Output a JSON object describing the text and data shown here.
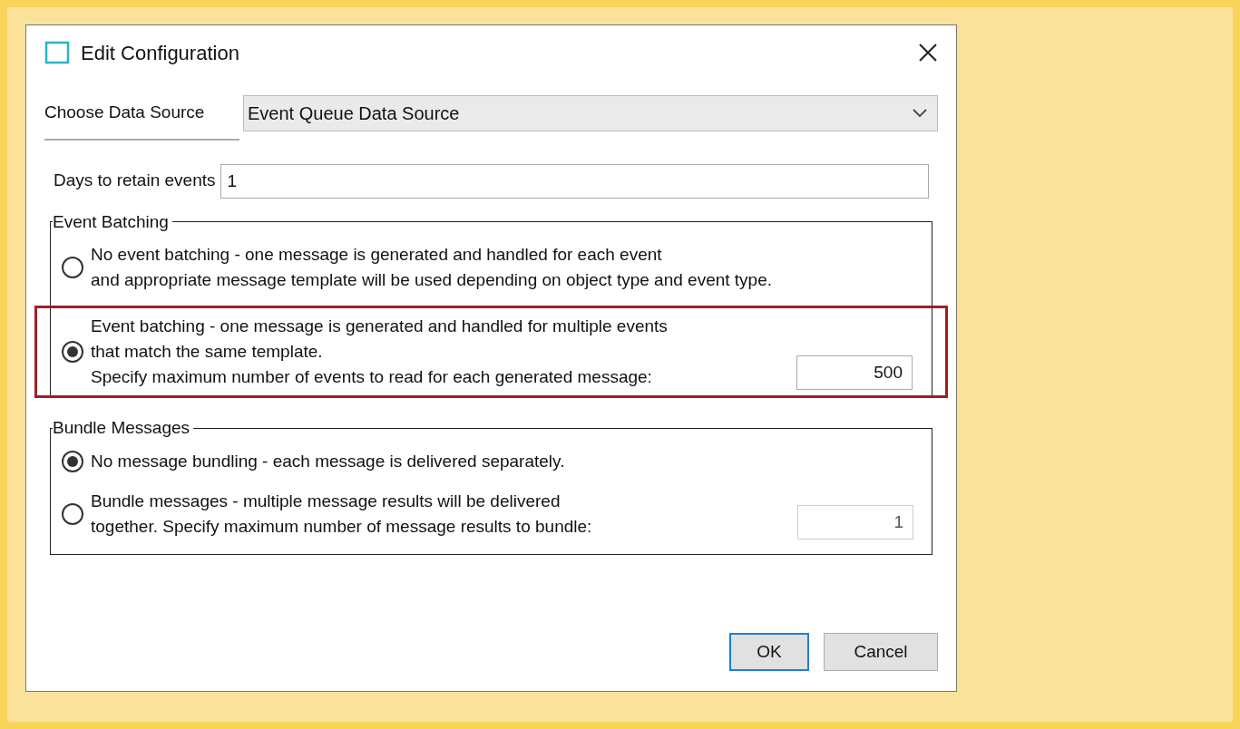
{
  "window": {
    "title": "Edit Configuration"
  },
  "data_source": {
    "label": "Choose Data Source",
    "value": "Event Queue Data Source"
  },
  "days": {
    "label": "Days to retain events",
    "value": "1"
  },
  "groups": [
    {
      "title": "Event Batching",
      "options": [
        {
          "text": "No event batching - one message is generated and handled for each event\nand appropriate message template will be used depending on object type and event type.",
          "selected": false,
          "highlighted": false
        },
        {
          "text": "Event batching - one message is generated and handled for multiple events\nthat match the same template.\nSpecify maximum number of events to read for each generated message:",
          "selected": true,
          "highlighted": true,
          "field": {
            "value": "500",
            "disabled": false
          }
        }
      ]
    },
    {
      "title": "Bundle Messages",
      "options": [
        {
          "text": "No message bundling - each message is delivered separately.",
          "selected": true,
          "highlighted": false
        },
        {
          "text": "Bundle messages - multiple message results will be delivered\ntogether. Specify maximum number of message results to bundle:",
          "selected": false,
          "highlighted": false,
          "field": {
            "value": "1",
            "disabled": true
          }
        }
      ]
    }
  ],
  "buttons": [
    {
      "label": "OK",
      "default": true
    },
    {
      "label": "Cancel",
      "default": false
    }
  ]
}
